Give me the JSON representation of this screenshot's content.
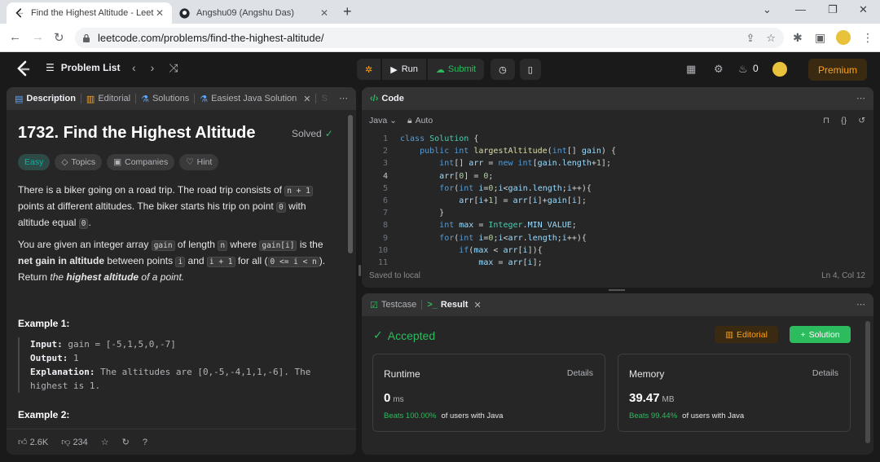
{
  "browser": {
    "tabs": [
      {
        "title": "Find the Highest Altitude - Leet",
        "active": true
      },
      {
        "title": "Angshu09 (Angshu Das)",
        "active": false
      }
    ],
    "url": "leetcode.com/problems/find-the-highest-altitude/"
  },
  "nav": {
    "problem_list": "Problem List",
    "run": "Run",
    "submit": "Submit",
    "streak_count": "0",
    "premium": "Premium"
  },
  "desc": {
    "tabs": [
      "Description",
      "Editorial",
      "Solutions",
      "Easiest Java Solution",
      "S"
    ],
    "title": "1732. Find the Highest Altitude",
    "solved": "Solved",
    "chips": [
      "Easy",
      "Topics",
      "Companies",
      "Hint"
    ],
    "p1": {
      "a": "There is a biker going on a road trip. The road trip consists of",
      "c1": "n + 1",
      "b": "points at different altitudes. The biker starts his trip on point",
      "c2": "0",
      "c": "with altitude equal",
      "c3": "0",
      "d": "."
    },
    "p2": {
      "a": "You are given an integer array",
      "c1": "gain",
      "b": "of length",
      "c2": "n",
      "c": "where",
      "c3": "gain[i]",
      "d": "is the",
      "bold1": "net gain in altitude",
      "e": "between points",
      "c4": "i",
      "f": "and",
      "c5": "i + 1",
      "g": "for all (",
      "c6": "0 <= i < n",
      "h": ").",
      "i": "Return",
      "em1": "the",
      "bold2": "highest altitude",
      "em2": "of a point."
    },
    "example1_title": "Example 1:",
    "example1": {
      "input_label": "Input:",
      "input": "gain = [-5,1,5,0,-7]",
      "output_label": "Output:",
      "output": "1",
      "expl_label": "Explanation:",
      "expl": "The altitudes are [0,-5,-4,1,1,-6]. The highest is 1."
    },
    "example2_title": "Example 2:",
    "likes": "2.6K",
    "dislikes": "234"
  },
  "code": {
    "header": "Code",
    "language": "Java",
    "mode": "Auto",
    "line_numbers": [
      "1",
      "2",
      "3",
      "4",
      "5",
      "6",
      "7",
      "8",
      "9",
      "10",
      "11"
    ],
    "status_left": "Saved to local",
    "status_right": "Ln 4, Col 12"
  },
  "result": {
    "tabs": [
      "Testcase",
      "Result"
    ],
    "status": "Accepted",
    "editorial_btn": "Editorial",
    "solution_btn": "Solution",
    "runtime": {
      "label": "Runtime",
      "details": "Details",
      "value": "0",
      "unit": "ms",
      "beats": "Beats 100.00%",
      "suffix": "of users with Java"
    },
    "memory": {
      "label": "Memory",
      "details": "Details",
      "value": "39.47",
      "unit": "MB",
      "beats": "Beats 99.44%",
      "suffix": "of users with Java"
    }
  },
  "colors": {
    "accent_orange": "#ffa116",
    "accepted_green": "#2cbb5d",
    "easy_teal": "#00b8a3"
  }
}
